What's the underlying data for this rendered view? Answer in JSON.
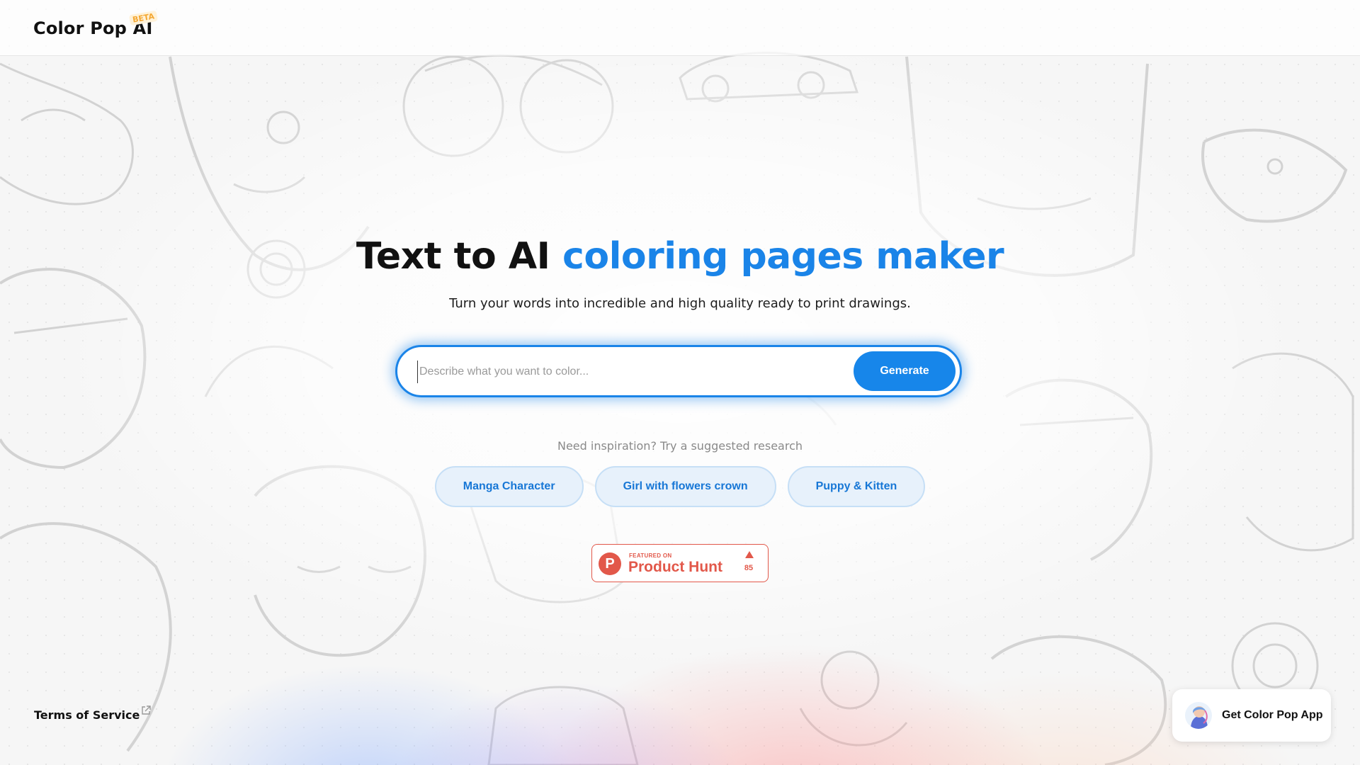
{
  "header": {
    "logo": "Color Pop AI",
    "badge": "BETA"
  },
  "hero": {
    "title_plain": "Text to AI ",
    "title_accent": "coloring pages maker",
    "subtitle": "Turn your words into incredible and high quality ready to print drawings."
  },
  "search": {
    "placeholder": "Describe what you want to color...",
    "value": "",
    "button_label": "Generate"
  },
  "suggestions": {
    "heading": "Need inspiration? Try a suggested research",
    "items": [
      "Manga Character",
      "Girl with flowers crown",
      "Puppy & Kitten"
    ]
  },
  "product_hunt": {
    "featured": "FEATURED ON",
    "name": "Product Hunt",
    "votes": "85",
    "logo_letter": "P"
  },
  "footer": {
    "terms": "Terms of Service",
    "app_button": "Get Color Pop App"
  },
  "colors": {
    "accent": "#1a84e8",
    "product_hunt": "#e2584a",
    "beta": "#f4a833"
  },
  "icons": {
    "external_link": "external-link-icon",
    "upvote": "triangle-up-icon"
  }
}
